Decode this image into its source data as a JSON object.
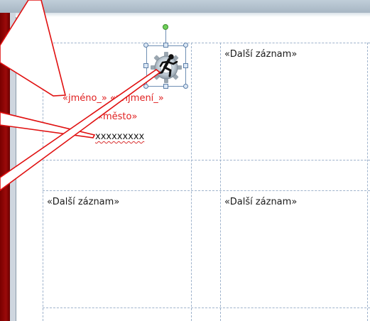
{
  "document": {
    "cells": [
      {
        "row": 1,
        "col": 2,
        "text": "«Další záznam»"
      },
      {
        "row": 3,
        "col": 1,
        "text": "«Další záznam»"
      },
      {
        "row": 3,
        "col": 2,
        "text": "«Další záznam»"
      }
    ],
    "first_cell": {
      "name_line": "«jméno_» «příjmení_»",
      "city_line": "«město»",
      "placeholder": "xxxxxxxxx"
    },
    "image": {
      "icon": "gear-running-man-icon",
      "selected": true
    }
  },
  "colors": {
    "merge_field_red": "#e02020",
    "callout_red": "#e01010",
    "window_edge": "#8b0000",
    "gridline": "#9fb3cc"
  }
}
